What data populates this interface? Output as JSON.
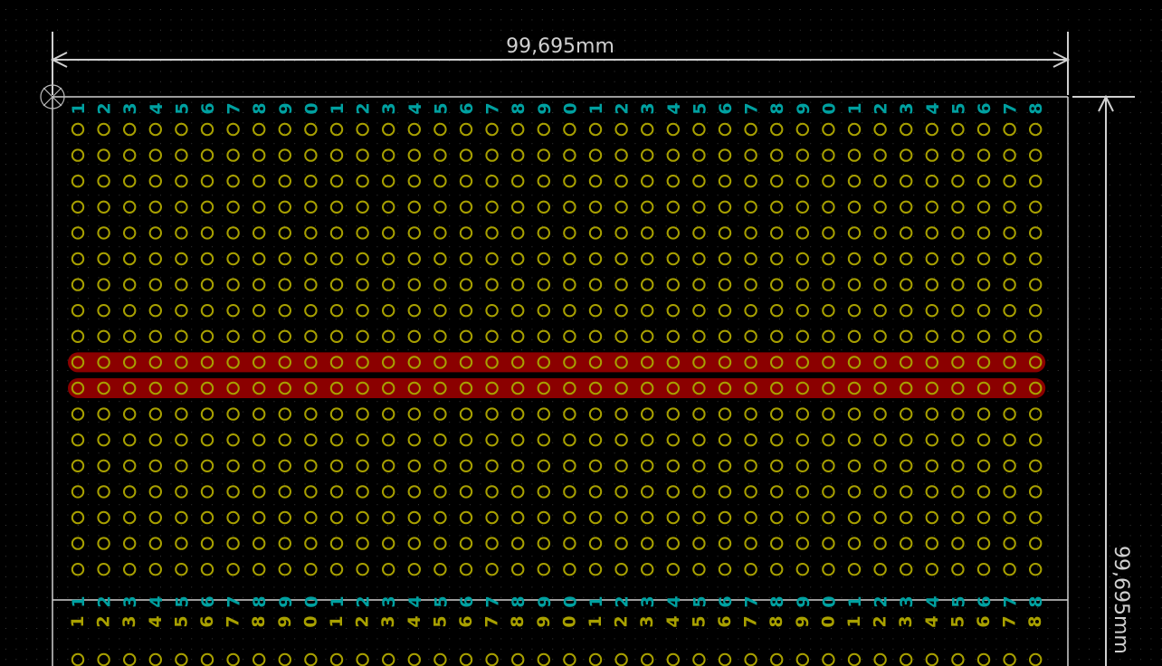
{
  "view": {
    "app": "PCB layout view",
    "colors": {
      "background": "#000000",
      "grid_dot": "#3a3a3a",
      "board_edge": "#d0d0d0",
      "dimension": "#d0d0d0",
      "pad_ring": "#a8a000",
      "copper_trace": "#8b0000",
      "column_label": "#00a0a0",
      "origin_marker": "#bbbbbb"
    }
  },
  "dimensions": {
    "horizontal": {
      "label": "99,695mm"
    },
    "vertical": {
      "label": "99,695mm"
    }
  },
  "pad_grid": {
    "columns": 38,
    "upper_rows": 18,
    "lower_rows_visible": 1,
    "trace_rows": [
      9,
      10
    ]
  },
  "column_labels": [
    "1",
    "2",
    "3",
    "4",
    "5",
    "6",
    "7",
    "8",
    "9",
    "0",
    "1",
    "2",
    "3",
    "4",
    "5",
    "6",
    "7",
    "8",
    "9",
    "0",
    "1",
    "2",
    "3",
    "4",
    "5",
    "6",
    "7",
    "8",
    "9",
    "0",
    "1",
    "2",
    "3",
    "4",
    "5",
    "6",
    "7",
    "8"
  ]
}
